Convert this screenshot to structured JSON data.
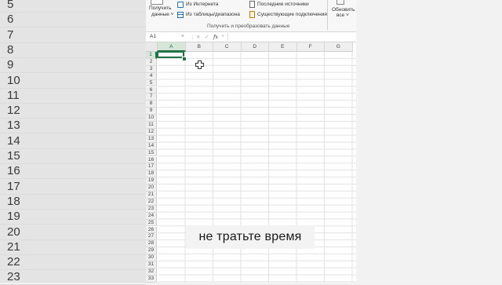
{
  "background": {
    "left_row_numbers": [
      "5",
      "6",
      "7",
      "8",
      "9",
      "10",
      "11",
      "12",
      "13",
      "14",
      "15",
      "16",
      "17",
      "18",
      "19",
      "20",
      "21",
      "22",
      "23"
    ]
  },
  "ribbon": {
    "get_data_label_1": "Получить",
    "get_data_label_2": "данные",
    "from_web": "Из Интернета",
    "from_table": "Из таблицы/диапазона",
    "recent_sources": "Последние источники",
    "existing_connections": "Существующие подключения",
    "refresh_label_1": "Обновить",
    "refresh_label_2": "все",
    "group_label": "Получить и преобразовать данные"
  },
  "formula_bar": {
    "name_box": "A1",
    "fx_label": "fx",
    "value": ""
  },
  "sheet": {
    "columns": [
      "A",
      "B",
      "C",
      "D",
      "E",
      "F",
      "G"
    ],
    "rows": [
      "1",
      "2",
      "3",
      "4",
      "5",
      "6",
      "7",
      "8",
      "9",
      "10",
      "11",
      "12",
      "13",
      "14",
      "15",
      "16",
      "17",
      "18",
      "19",
      "20",
      "21",
      "22",
      "23",
      "24",
      "25",
      "26",
      "27",
      "28",
      "29",
      "30",
      "31",
      "32",
      "33"
    ],
    "active_cell": "A1"
  },
  "caption": "не тратьте время",
  "colors": {
    "accent": "#217346",
    "header_bg": "#efefef",
    "ribbon_bg": "#f7f7f7"
  }
}
